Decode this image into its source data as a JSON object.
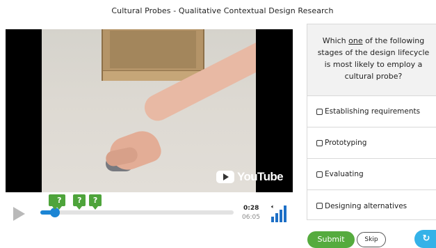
{
  "header": {
    "title": "Cultural Probes - Qualitative Contextual Design Research"
  },
  "video": {
    "watermark": "YouTube",
    "current_time": "0:28",
    "total_time": "06:05",
    "progress": 0.077,
    "marker_label": "?",
    "markers_at_seconds": [
      20,
      28,
      66,
      96
    ],
    "volume_level": 1.0,
    "accent_color": "#1c85d4",
    "marker_color": "#4ea43b"
  },
  "quiz": {
    "question_before": "Which ",
    "question_emphasis": "one",
    "question_after": " of the following stages of the design lifecycle is most likely to employ a cultural probe?",
    "options": [
      {
        "label": "Establishing requirements",
        "checked": false
      },
      {
        "label": "Prototyping",
        "checked": false
      },
      {
        "label": "Evaluating",
        "checked": false
      },
      {
        "label": "Designing alternatives",
        "checked": false
      }
    ]
  },
  "actions": {
    "submit_label": "Submit",
    "skip_label": "Skip",
    "undo_icon": "undo-icon",
    "submit_color": "#55ab3e",
    "undo_color": "#34b2e8"
  }
}
